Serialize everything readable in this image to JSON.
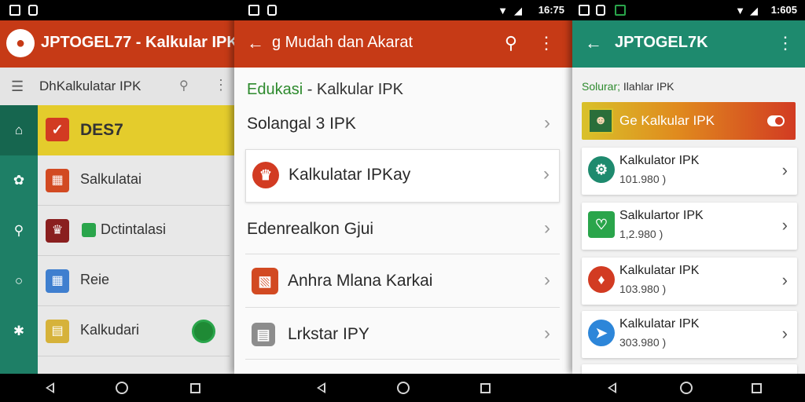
{
  "panel1": {
    "time": "",
    "app_title": "JPTOGEL77 - Kalkular IPK",
    "search_text": "DhKalkulatar IPK",
    "featured": "DES7",
    "items": [
      {
        "label": "Salkulatai",
        "color": "#d24a22"
      },
      {
        "label": "Dctintalasi",
        "color": "#8a1f1f"
      },
      {
        "label": "Reie",
        "color": "#3f7fcf"
      },
      {
        "label": "Kalkudari",
        "color": "#d6b23a"
      }
    ]
  },
  "panel2": {
    "time": "16:75",
    "title": "g Mudah dan Akarat",
    "heading_green": "Edukasi",
    "heading_rest": " - Kalkular IPK",
    "rows": [
      {
        "label": "Solangal 3 IPK"
      },
      {
        "label": "Kalkulatar IPKay"
      },
      {
        "label": "Edenrealkon Gjui"
      },
      {
        "label": "Anhra Mlana Karkai"
      },
      {
        "label": "Lrkstar IPY"
      }
    ]
  },
  "panel3": {
    "time": "1:605",
    "title": "JPTOGEL7K",
    "heading_green": "Solurar;",
    "heading_rest": " Ilahlar IPK",
    "banner": "Ge Kalkular IPK",
    "cards": [
      {
        "title": "Kalkulator IPK",
        "sub": "101.980 )",
        "color": "#1e8a6e"
      },
      {
        "title": "Salkulartor IPK",
        "sub": "1,2.980 )",
        "color": "#2aa54b"
      },
      {
        "title": "Kalkulatar IPK",
        "sub": "103.980 )",
        "color": "#d23b22"
      },
      {
        "title": "Kalkulatar IPK",
        "sub": "303.980 )",
        "color": "#2d86d9"
      }
    ]
  },
  "colors": {
    "primary_red": "#c63a16",
    "primary_teal": "#1e8a6e",
    "accent_yellow": "#e4cc2c"
  }
}
